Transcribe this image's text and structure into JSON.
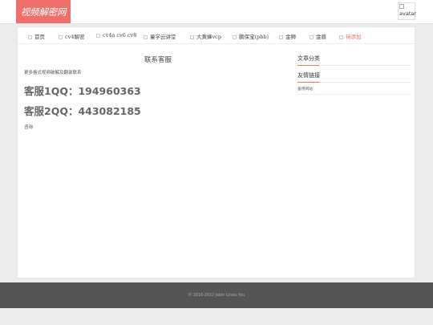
{
  "header": {
    "logo_text": "视频解密网",
    "avatar_alt": "avatar"
  },
  "nav": {
    "items": [
      {
        "label": "首页"
      },
      {
        "label": "cv4解密"
      },
      {
        "label": "cv4a cv6 cv8"
      },
      {
        "label": "童学云讲堂"
      },
      {
        "label": "大黄蜂vcp"
      },
      {
        "label": "鹏保宝(pbb)"
      },
      {
        "label": "金狮"
      },
      {
        "label": "金盾"
      },
      {
        "label": "待添加",
        "active": true
      }
    ]
  },
  "main": {
    "title": "联系客服",
    "description": "更多格式视频破解及翻录联系",
    "qq1": "客服1QQ：194960363",
    "qq2": "客服2QQ：443082185",
    "note": "咨询"
  },
  "sidebar": {
    "article_categories_title": "文章分类",
    "friend_links_title": "友情链接",
    "friend_links": [
      {
        "label": "备用网站"
      }
    ]
  },
  "footer": {
    "copyright": "© 2016-2022 Jabin Loves You"
  },
  "colors": {
    "accent": "#ef6f6a",
    "footer_bg": "#555555",
    "page_bg": "#ececec"
  }
}
